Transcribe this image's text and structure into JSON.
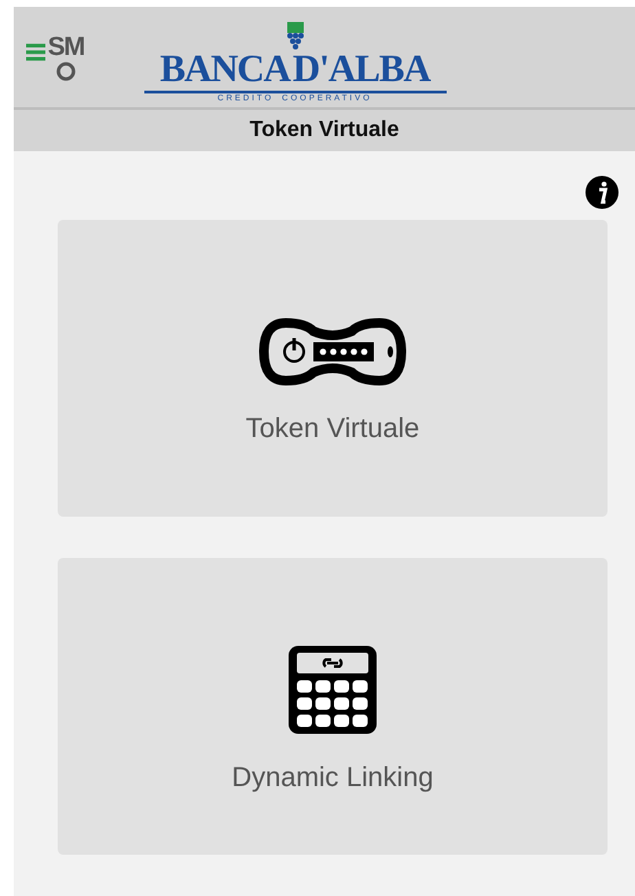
{
  "header": {
    "app_badge": "SM",
    "logo": {
      "name_left": "BANCA",
      "name_right": "D'ALBA",
      "tagline_left": "CREDITO",
      "tagline_right": "COOPERATIVO"
    }
  },
  "title_bar": {
    "title": "Token Virtuale"
  },
  "tiles": [
    {
      "kind": "token",
      "label": "Token Virtuale"
    },
    {
      "kind": "calculator",
      "label": "Dynamic Linking"
    }
  ]
}
